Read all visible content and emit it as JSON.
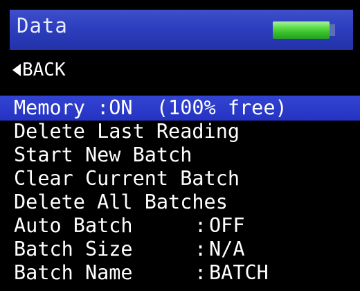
{
  "header": {
    "title": "Data",
    "battery_icon": "battery-full-icon",
    "battery_level": 1.0
  },
  "nav": {
    "back_label": "BACK",
    "back_icon": "triangle-left-icon"
  },
  "menu": {
    "items": [
      {
        "label": "Memory :ON  (100% free)"
      },
      {
        "label": "Delete Last Reading"
      },
      {
        "label": "Start New Batch"
      },
      {
        "label": "Clear Current Batch"
      },
      {
        "label": "Delete All Batches"
      },
      {
        "label": "Auto Batch",
        "sep": ":",
        "value": "OFF"
      },
      {
        "label": "Batch Size",
        "sep": ":",
        "value": "N/A"
      },
      {
        "label": "Batch Name",
        "sep": ":",
        "value": "BATCH"
      }
    ],
    "selected_index": 0
  },
  "colors": {
    "background": "#000000",
    "title_bar": "#2d3fbf",
    "selection": "#2b3ac8",
    "text": "#ffffff",
    "battery": "#4fd03a"
  }
}
